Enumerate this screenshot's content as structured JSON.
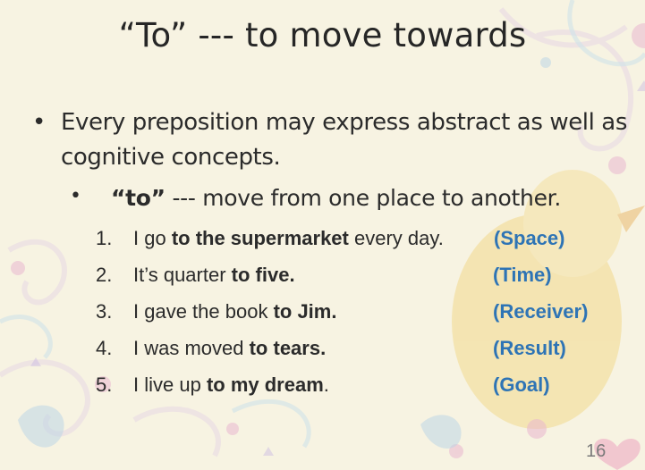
{
  "slide": {
    "title": "“To” --- to move towards",
    "bullet_marker": "•",
    "bullet1_text": "Every preposition may express abstract as well as cognitive concepts.",
    "sub_bullet_marker": "•",
    "sub_bullet": {
      "bold": "“to”",
      "rest": " --- move from one place to another."
    },
    "examples": [
      {
        "num": "1.",
        "pre": "I go ",
        "bold": "to the supermarket",
        "post": " every day.",
        "tag": "(Space)"
      },
      {
        "num": "2.",
        "pre": "It’s quarter ",
        "bold": "to five.",
        "post": "",
        "tag": "(Time)"
      },
      {
        "num": "3.",
        "pre": "I gave the book ",
        "bold": "to Jim.",
        "post": "",
        "tag": "(Receiver)"
      },
      {
        "num": "4.",
        "pre": "I was moved ",
        "bold": "to tears.",
        "post": "",
        "tag": "(Result)"
      },
      {
        "num": "5.",
        "pre": "I live up ",
        "bold": "to my dream",
        "post": ".",
        "tag": "(Goal)"
      }
    ],
    "page_number": "16"
  },
  "colors": {
    "background": "#f7f3e2",
    "tag_blue": "#2e74b5",
    "text": "#2b2b2b"
  }
}
